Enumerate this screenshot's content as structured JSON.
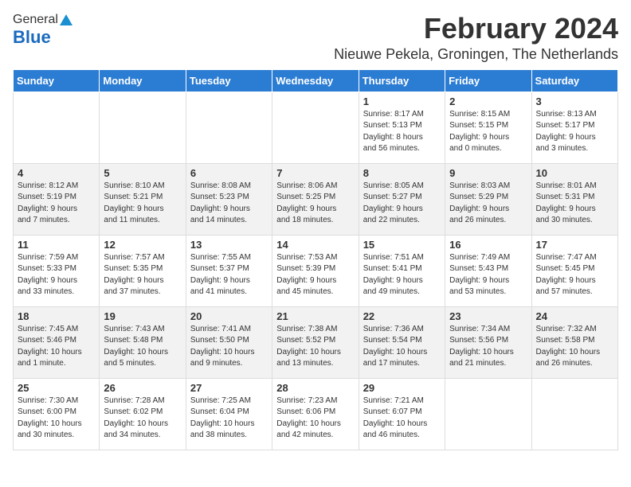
{
  "logo": {
    "general": "General",
    "blue": "Blue"
  },
  "header": {
    "title": "February 2024",
    "subtitle": "Nieuwe Pekela, Groningen, The Netherlands"
  },
  "weekdays": [
    "Sunday",
    "Monday",
    "Tuesday",
    "Wednesday",
    "Thursday",
    "Friday",
    "Saturday"
  ],
  "weeks": [
    [
      {
        "day": "",
        "detail": ""
      },
      {
        "day": "",
        "detail": ""
      },
      {
        "day": "",
        "detail": ""
      },
      {
        "day": "",
        "detail": ""
      },
      {
        "day": "1",
        "detail": "Sunrise: 8:17 AM\nSunset: 5:13 PM\nDaylight: 8 hours\nand 56 minutes."
      },
      {
        "day": "2",
        "detail": "Sunrise: 8:15 AM\nSunset: 5:15 PM\nDaylight: 9 hours\nand 0 minutes."
      },
      {
        "day": "3",
        "detail": "Sunrise: 8:13 AM\nSunset: 5:17 PM\nDaylight: 9 hours\nand 3 minutes."
      }
    ],
    [
      {
        "day": "4",
        "detail": "Sunrise: 8:12 AM\nSunset: 5:19 PM\nDaylight: 9 hours\nand 7 minutes."
      },
      {
        "day": "5",
        "detail": "Sunrise: 8:10 AM\nSunset: 5:21 PM\nDaylight: 9 hours\nand 11 minutes."
      },
      {
        "day": "6",
        "detail": "Sunrise: 8:08 AM\nSunset: 5:23 PM\nDaylight: 9 hours\nand 14 minutes."
      },
      {
        "day": "7",
        "detail": "Sunrise: 8:06 AM\nSunset: 5:25 PM\nDaylight: 9 hours\nand 18 minutes."
      },
      {
        "day": "8",
        "detail": "Sunrise: 8:05 AM\nSunset: 5:27 PM\nDaylight: 9 hours\nand 22 minutes."
      },
      {
        "day": "9",
        "detail": "Sunrise: 8:03 AM\nSunset: 5:29 PM\nDaylight: 9 hours\nand 26 minutes."
      },
      {
        "day": "10",
        "detail": "Sunrise: 8:01 AM\nSunset: 5:31 PM\nDaylight: 9 hours\nand 30 minutes."
      }
    ],
    [
      {
        "day": "11",
        "detail": "Sunrise: 7:59 AM\nSunset: 5:33 PM\nDaylight: 9 hours\nand 33 minutes."
      },
      {
        "day": "12",
        "detail": "Sunrise: 7:57 AM\nSunset: 5:35 PM\nDaylight: 9 hours\nand 37 minutes."
      },
      {
        "day": "13",
        "detail": "Sunrise: 7:55 AM\nSunset: 5:37 PM\nDaylight: 9 hours\nand 41 minutes."
      },
      {
        "day": "14",
        "detail": "Sunrise: 7:53 AM\nSunset: 5:39 PM\nDaylight: 9 hours\nand 45 minutes."
      },
      {
        "day": "15",
        "detail": "Sunrise: 7:51 AM\nSunset: 5:41 PM\nDaylight: 9 hours\nand 49 minutes."
      },
      {
        "day": "16",
        "detail": "Sunrise: 7:49 AM\nSunset: 5:43 PM\nDaylight: 9 hours\nand 53 minutes."
      },
      {
        "day": "17",
        "detail": "Sunrise: 7:47 AM\nSunset: 5:45 PM\nDaylight: 9 hours\nand 57 minutes."
      }
    ],
    [
      {
        "day": "18",
        "detail": "Sunrise: 7:45 AM\nSunset: 5:46 PM\nDaylight: 10 hours\nand 1 minute."
      },
      {
        "day": "19",
        "detail": "Sunrise: 7:43 AM\nSunset: 5:48 PM\nDaylight: 10 hours\nand 5 minutes."
      },
      {
        "day": "20",
        "detail": "Sunrise: 7:41 AM\nSunset: 5:50 PM\nDaylight: 10 hours\nand 9 minutes."
      },
      {
        "day": "21",
        "detail": "Sunrise: 7:38 AM\nSunset: 5:52 PM\nDaylight: 10 hours\nand 13 minutes."
      },
      {
        "day": "22",
        "detail": "Sunrise: 7:36 AM\nSunset: 5:54 PM\nDaylight: 10 hours\nand 17 minutes."
      },
      {
        "day": "23",
        "detail": "Sunrise: 7:34 AM\nSunset: 5:56 PM\nDaylight: 10 hours\nand 21 minutes."
      },
      {
        "day": "24",
        "detail": "Sunrise: 7:32 AM\nSunset: 5:58 PM\nDaylight: 10 hours\nand 26 minutes."
      }
    ],
    [
      {
        "day": "25",
        "detail": "Sunrise: 7:30 AM\nSunset: 6:00 PM\nDaylight: 10 hours\nand 30 minutes."
      },
      {
        "day": "26",
        "detail": "Sunrise: 7:28 AM\nSunset: 6:02 PM\nDaylight: 10 hours\nand 34 minutes."
      },
      {
        "day": "27",
        "detail": "Sunrise: 7:25 AM\nSunset: 6:04 PM\nDaylight: 10 hours\nand 38 minutes."
      },
      {
        "day": "28",
        "detail": "Sunrise: 7:23 AM\nSunset: 6:06 PM\nDaylight: 10 hours\nand 42 minutes."
      },
      {
        "day": "29",
        "detail": "Sunrise: 7:21 AM\nSunset: 6:07 PM\nDaylight: 10 hours\nand 46 minutes."
      },
      {
        "day": "",
        "detail": ""
      },
      {
        "day": "",
        "detail": ""
      }
    ]
  ]
}
